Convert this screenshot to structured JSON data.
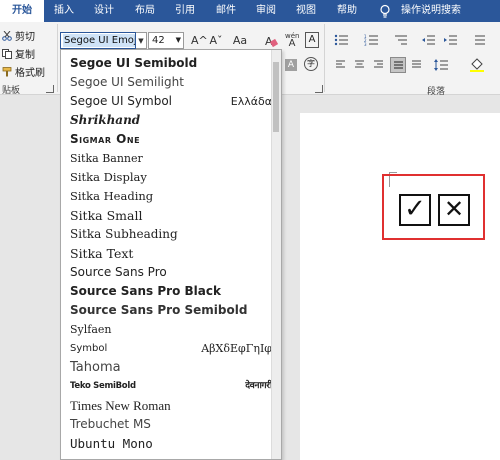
{
  "ribbon_tabs": [
    {
      "label": "开始",
      "active": true
    },
    {
      "label": "插入"
    },
    {
      "label": "设计"
    },
    {
      "label": "布局"
    },
    {
      "label": "引用"
    },
    {
      "label": "邮件"
    },
    {
      "label": "审阅"
    },
    {
      "label": "视图"
    },
    {
      "label": "帮助"
    },
    {
      "label": "操作说明搜索"
    }
  ],
  "clipboard": {
    "cut": "剪切",
    "copy": "复制",
    "format_painter": "格式刷",
    "group_label": "贴板"
  },
  "font_group": {
    "font_name": "Segoe UI Emoji",
    "font_size": "42",
    "grow_icon": "A^",
    "shrink_icon": "Aˇ",
    "case_label": "Aa",
    "pinyin_label": "wén",
    "pinyin_char": "A"
  },
  "paragraph": {
    "group_label": "段落"
  },
  "font_list": [
    {
      "name": "Segoe UI Semibold",
      "sample": ""
    },
    {
      "name": "Segoe UI Semilight",
      "sample": ""
    },
    {
      "name": "Segoe UI Symbol",
      "sample": "Ελλάδα"
    },
    {
      "name": "Shrikhand",
      "sample": ""
    },
    {
      "name": "Sigmar One",
      "sample": ""
    },
    {
      "name": "Sitka Banner",
      "sample": ""
    },
    {
      "name": "Sitka Display",
      "sample": ""
    },
    {
      "name": "Sitka Heading",
      "sample": ""
    },
    {
      "name": "Sitka Small",
      "sample": ""
    },
    {
      "name": "Sitka Subheading",
      "sample": ""
    },
    {
      "name": "Sitka Text",
      "sample": ""
    },
    {
      "name": "Source Sans Pro",
      "sample": ""
    },
    {
      "name": "Source Sans Pro Black",
      "sample": ""
    },
    {
      "name": "Source Sans Pro Semibold",
      "sample": ""
    },
    {
      "name": "Sylfaen",
      "sample": ""
    },
    {
      "name": "Symbol",
      "sample": "ΑβΧδΕφΓηΙφ"
    },
    {
      "name": "Tahoma",
      "sample": ""
    },
    {
      "name": "Teko SemiBold",
      "sample": "देवनागरी"
    },
    {
      "name": "Times New Roman",
      "sample": ""
    },
    {
      "name": "Trebuchet MS",
      "sample": ""
    },
    {
      "name": "Ubuntu Mono",
      "sample": ""
    }
  ],
  "document": {
    "check_symbol": "✓",
    "cross_symbol": "✕"
  },
  "colors": {
    "ribbon_blue": "#2b579a",
    "highlight_red": "#e03030"
  }
}
